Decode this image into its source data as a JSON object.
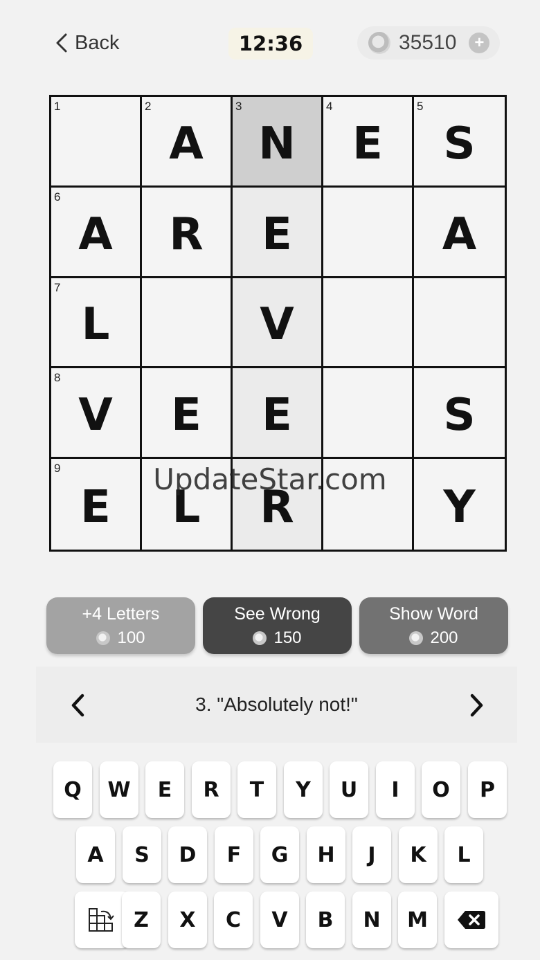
{
  "header": {
    "back_label": "Back",
    "timer": "12:36",
    "coins": "35510"
  },
  "grid": {
    "rows": [
      [
        {
          "num": "1",
          "letter": ""
        },
        {
          "num": "2",
          "letter": "A"
        },
        {
          "num": "3",
          "letter": "N"
        },
        {
          "num": "4",
          "letter": "E"
        },
        {
          "num": "5",
          "letter": "S"
        }
      ],
      [
        {
          "num": "6",
          "letter": "A"
        },
        {
          "num": "",
          "letter": "R"
        },
        {
          "num": "",
          "letter": "E"
        },
        {
          "num": "",
          "letter": ""
        },
        {
          "num": "",
          "letter": "A"
        }
      ],
      [
        {
          "num": "7",
          "letter": "L"
        },
        {
          "num": "",
          "letter": ""
        },
        {
          "num": "",
          "letter": "V"
        },
        {
          "num": "",
          "letter": ""
        },
        {
          "num": "",
          "letter": ""
        }
      ],
      [
        {
          "num": "8",
          "letter": "V"
        },
        {
          "num": "",
          "letter": "E"
        },
        {
          "num": "",
          "letter": "E"
        },
        {
          "num": "",
          "letter": ""
        },
        {
          "num": "",
          "letter": "S"
        }
      ],
      [
        {
          "num": "9",
          "letter": "E"
        },
        {
          "num": "",
          "letter": "L"
        },
        {
          "num": "",
          "letter": "R"
        },
        {
          "num": "",
          "letter": ""
        },
        {
          "num": "",
          "letter": "Y"
        }
      ]
    ]
  },
  "watermark": "UpdateStar.com",
  "hints": [
    {
      "label": "+4 Letters",
      "cost": "100"
    },
    {
      "label": "See Wrong",
      "cost": "150"
    },
    {
      "label": "Show Word",
      "cost": "200"
    }
  ],
  "clue": {
    "text": "3. \"Absolutely not!\""
  },
  "keyboard": {
    "row1": [
      "Q",
      "W",
      "E",
      "R",
      "T",
      "Y",
      "U",
      "I",
      "O",
      "P"
    ],
    "row2": [
      "A",
      "S",
      "D",
      "F",
      "G",
      "H",
      "J",
      "K",
      "L"
    ],
    "row3": [
      "Z",
      "X",
      "C",
      "V",
      "B",
      "N",
      "M"
    ]
  },
  "icons": {
    "back": "chevron-left-icon",
    "coin": "coin-icon",
    "add": "plus-icon",
    "prev": "chevron-left-icon",
    "next": "chevron-right-icon",
    "rotate": "grid-rotate-icon",
    "backspace": "backspace-icon"
  },
  "colors": {
    "background": "#f2f2f2",
    "active_cell": "#cfcfcf",
    "word_cell": "#ebebeb",
    "hint_letters": "#a3a3a3",
    "hint_wrong": "#454545",
    "hint_word": "#727272",
    "timer_bg": "#f6f3e6"
  }
}
